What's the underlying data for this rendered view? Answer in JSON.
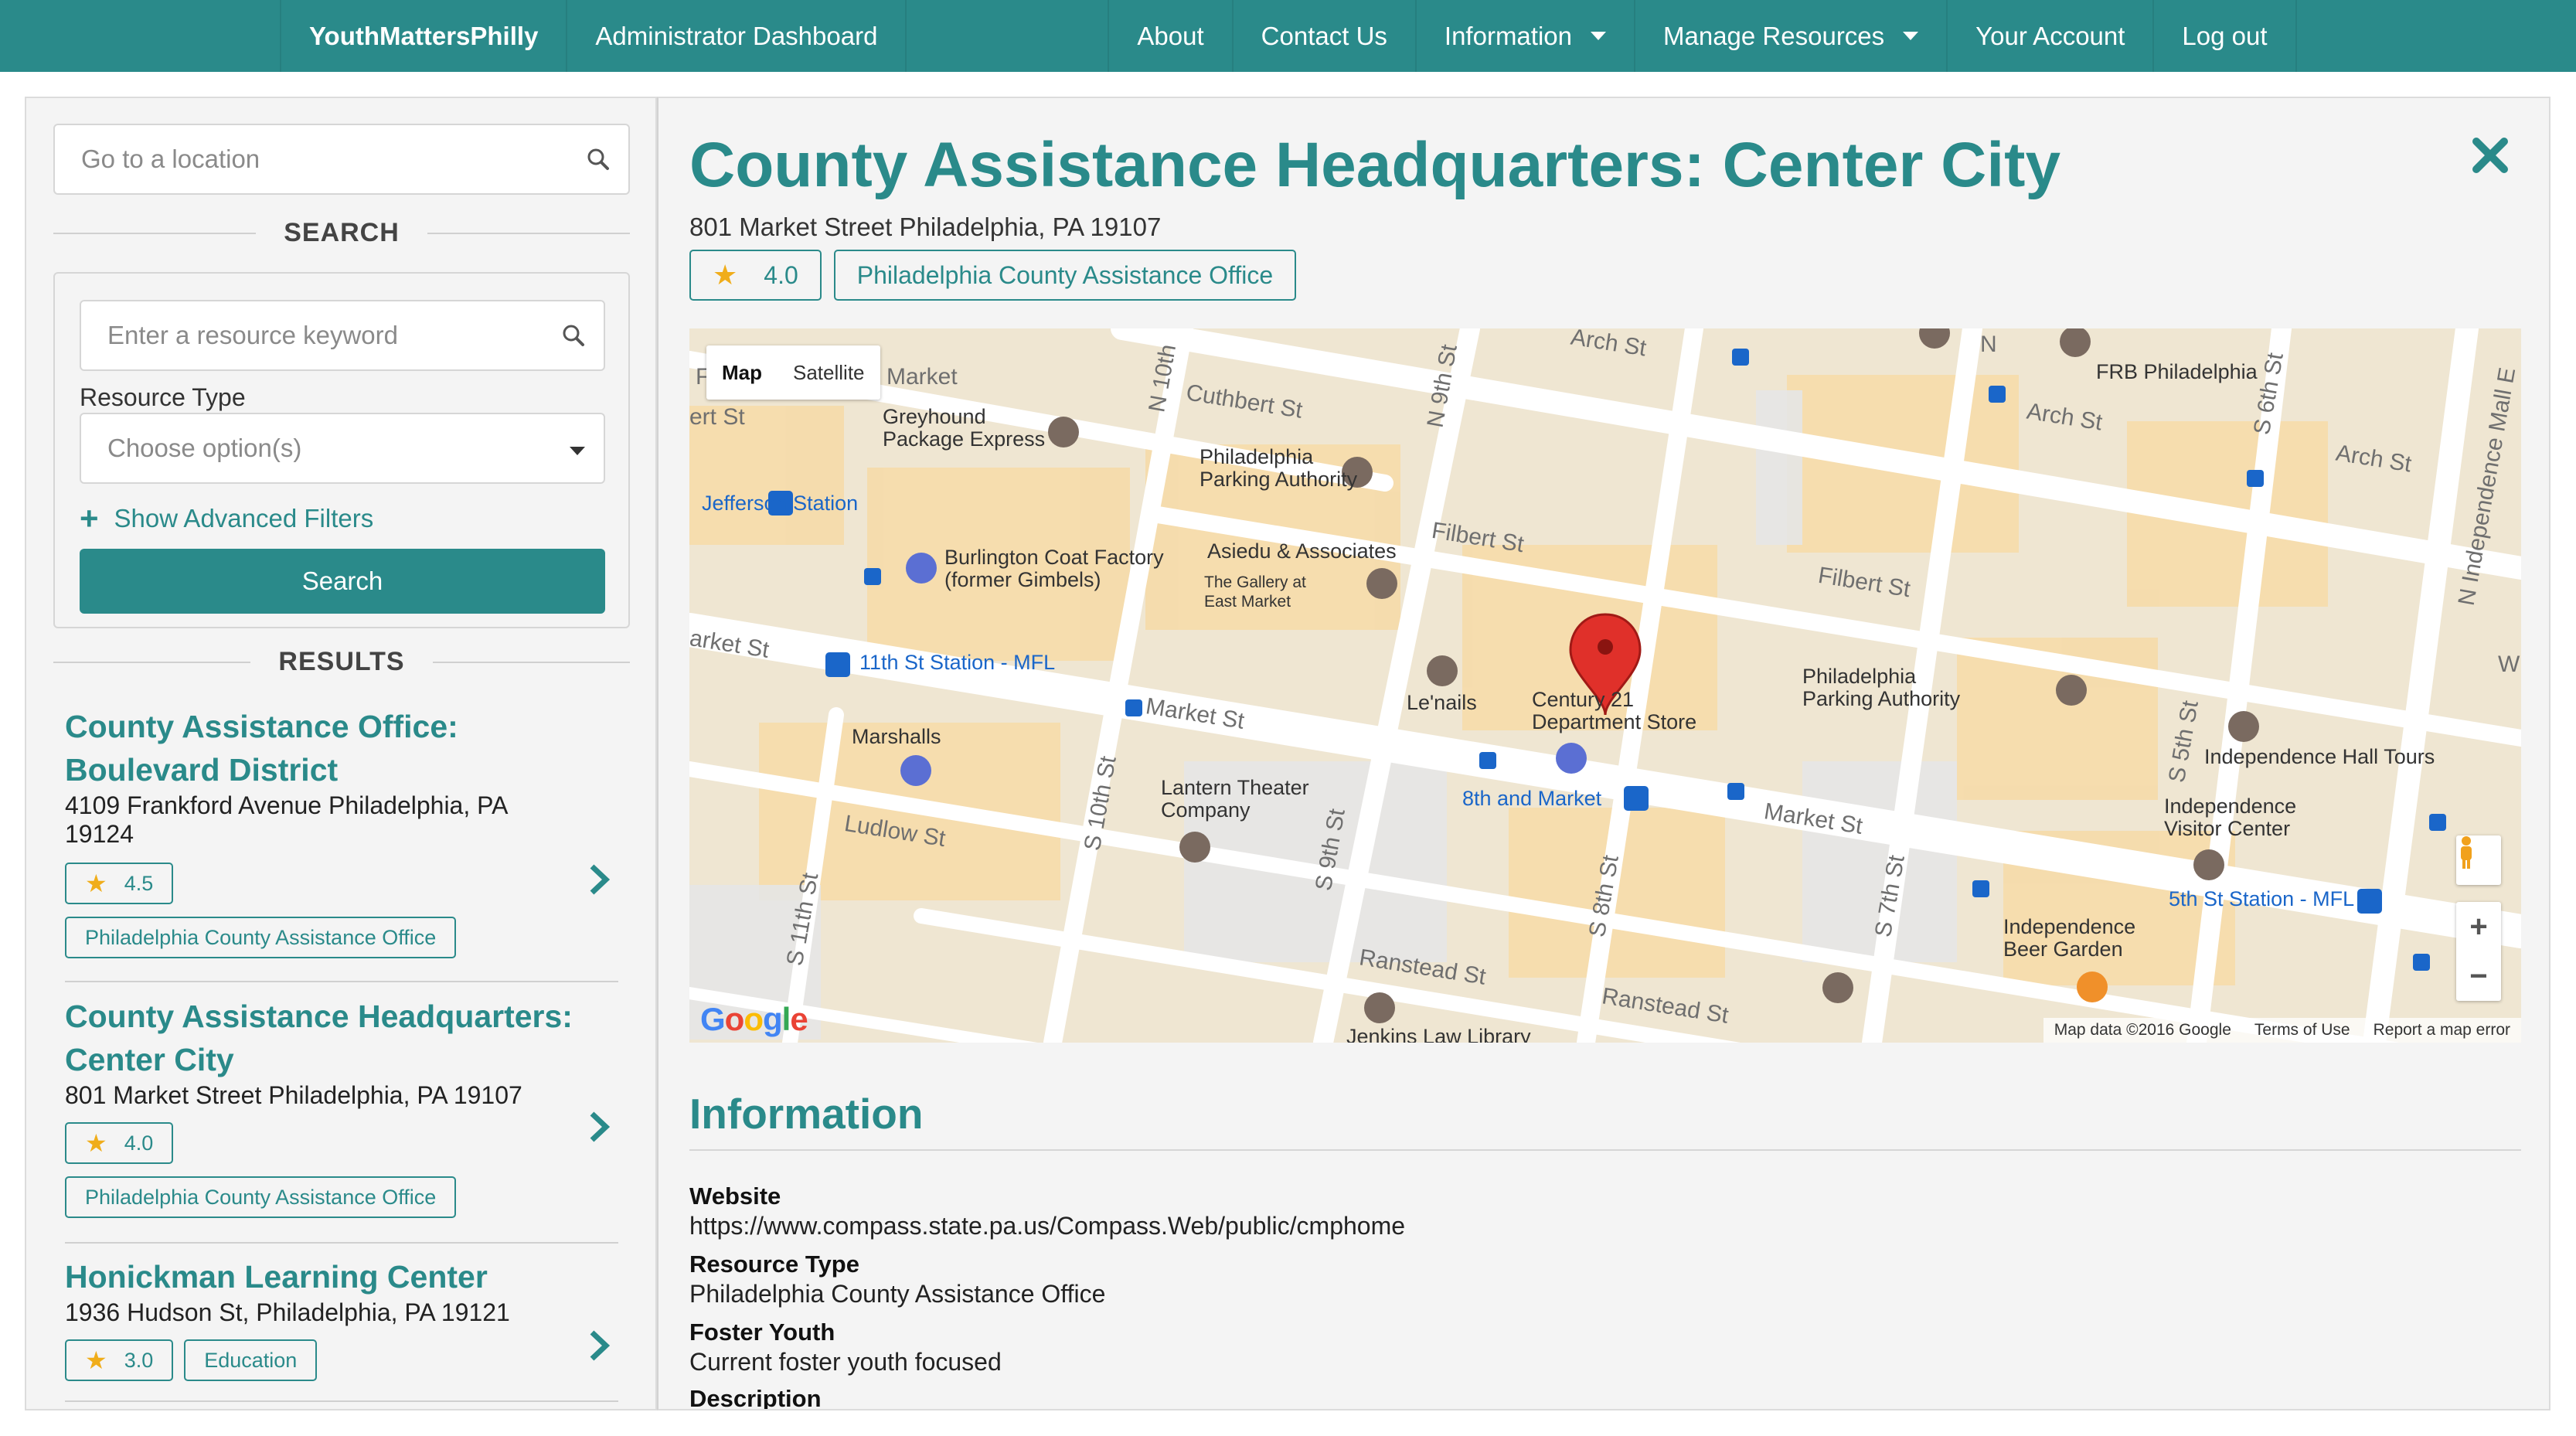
{
  "nav": {
    "brand": "YouthMattersPhilly",
    "dashboard": "Administrator Dashboard",
    "about": "About",
    "contact": "Contact Us",
    "information": "Information",
    "manage": "Manage Resources",
    "account": "Your Account",
    "logout": "Log out"
  },
  "sidebar": {
    "location_placeholder": "Go to a location",
    "search_heading": "SEARCH",
    "keyword_placeholder": "Enter a resource keyword",
    "resource_type_label": "Resource Type",
    "resource_type_placeholder": "Choose option(s)",
    "advanced_filters": "Show Advanced Filters",
    "search_button": "Search",
    "results_heading": "RESULTS",
    "results": [
      {
        "title": "County Assistance Office: Boulevard District",
        "address": "4109 Frankford Avenue Philadelphia, PA 19124",
        "rating": "4.5",
        "tag": "Philadelphia County Assistance Office"
      },
      {
        "title": "County Assistance Headquarters: Center City",
        "address": "801 Market Street Philadelphia, PA 19107",
        "rating": "4.0",
        "tag": "Philadelphia County Assistance Office"
      },
      {
        "title": "Honickman Learning Center",
        "address": "1936 Hudson St, Philadelphia, PA 19121",
        "rating": "3.0",
        "tag": "Education"
      }
    ]
  },
  "detail": {
    "title": "County Assistance Headquarters: Center City",
    "address": "801 Market Street Philadelphia, PA 19107",
    "rating": "4.0",
    "tag": "Philadelphia County Assistance Office",
    "map": {
      "toggle_map": "Map",
      "toggle_satellite": "Satellite",
      "footer_data": "Map data ©2016 Google",
      "footer_terms": "Terms of Use",
      "footer_report": "Report a map error",
      "logo": "Google",
      "labels": {
        "greyhound": "Greyhound\nPackage Express",
        "parking1": "Philadelphia\nParking Authority",
        "jefferson": "Jefferson Station",
        "burlington": "Burlington Coat Factory\n(former Gimbels)",
        "asiedu": "Asiedu & Associates",
        "gallery": "The Gallery at\nEast Market",
        "eleventh": "11th St Station - MFL",
        "marshalls": "Marshalls",
        "lenails": "Le'nails",
        "century": "Century 21\nDepartment Store",
        "parking2": "Philadelphia\nParking Authority",
        "lantern": "Lantern Theater\nCompany",
        "eighth": "8th and Market",
        "frb": "FRB Philadelphia",
        "indhall": "Independence Hall Tours",
        "visitor": "Independence\nVisitor Center",
        "fifth": "5th St Station - MFL",
        "beer": "Independence\nBeer Garden",
        "jenkins": "Jenkins Law Library",
        "market_w": "l Market",
        "arch1": "Arch St",
        "arch2": "Arch St",
        "arch3": "Arch St",
        "cuthbert": "Cuthbert St",
        "filbert1": "Filbert St",
        "filbert2": "Filbert St",
        "market1": "Market St",
        "market2": "Market St",
        "market_left": "arket St",
        "ludlow": "Ludlow St",
        "ranstead1": "Ranstead St",
        "ranstead2": "Ranstead St",
        "n10": "N 10th",
        "n9": "N 9th St",
        "s10": "S 10th St",
        "s9": "S 9th St",
        "s11": "S 11th St",
        "s8": "S 8th St",
        "s7": "S 7th St",
        "s6": "S 6th St",
        "s5": "S 5th St",
        "nindep": "N Independence Mall E",
        "n_letter": "N",
        "w_letter": "W",
        "ert": "ert St",
        "f_letter": "F"
      }
    },
    "info_heading": "Information",
    "info": [
      {
        "label": "Website",
        "value": "https://www.compass.state.pa.us/Compass.Web/public/cmphome"
      },
      {
        "label": "Resource Type",
        "value": "Philadelphia County Assistance Office"
      },
      {
        "label": "Foster Youth",
        "value": "Current foster youth focused"
      },
      {
        "label": "Description",
        "value": ""
      }
    ]
  },
  "colors": {
    "teal": "#2a8a8a",
    "star": "#f0ad1a",
    "pin": "#e0302a"
  }
}
